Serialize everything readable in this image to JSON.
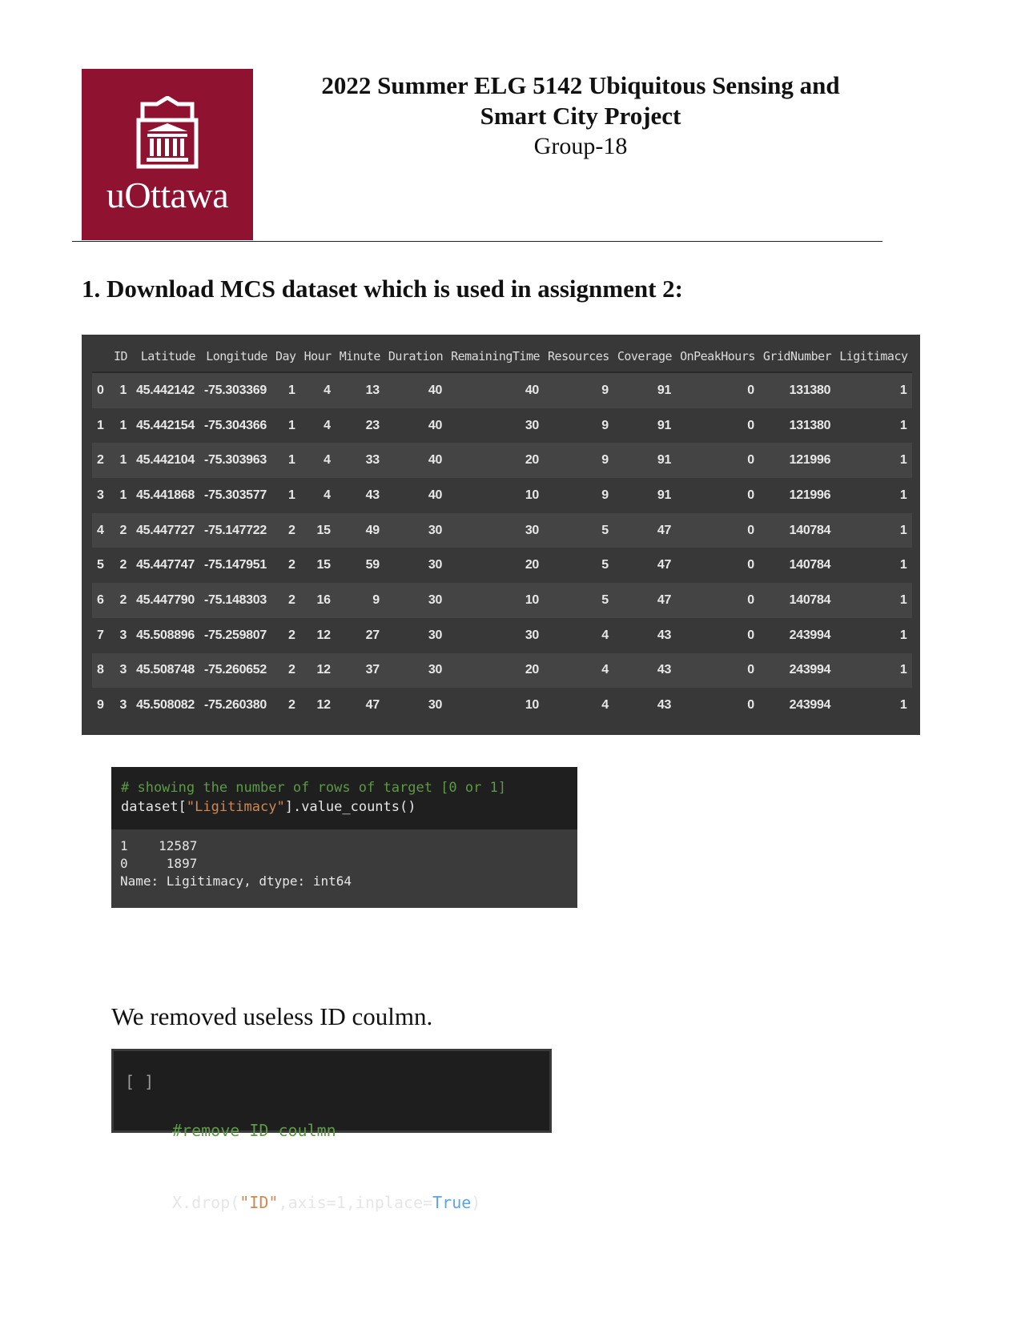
{
  "header": {
    "logo_text": "uOttawa",
    "title_line1": "2022 Summer ELG 5142 Ubiquitous Sensing and",
    "title_line2": "Smart City Project",
    "group": "Group-18"
  },
  "section": {
    "heading": "1. Download MCS dataset which is used in assignment 2:"
  },
  "colors": {
    "logo_bg": "#8f1330",
    "panel_bg": "#383838",
    "code_comment": "#5c9a45",
    "code_string": "#d1874f",
    "code_keyword": "#5aa4e8"
  },
  "dataframe": {
    "columns": [
      "",
      "ID",
      "Latitude",
      "Longitude",
      "Day",
      "Hour",
      "Minute",
      "Duration",
      "RemainingTime",
      "Resources",
      "Coverage",
      "OnPeakHours",
      "GridNumber",
      "Ligitimacy"
    ],
    "rows": [
      [
        "0",
        "1",
        "45.442142",
        "-75.303369",
        "1",
        "4",
        "13",
        "40",
        "40",
        "9",
        "91",
        "0",
        "131380",
        "1"
      ],
      [
        "1",
        "1",
        "45.442154",
        "-75.304366",
        "1",
        "4",
        "23",
        "40",
        "30",
        "9",
        "91",
        "0",
        "131380",
        "1"
      ],
      [
        "2",
        "1",
        "45.442104",
        "-75.303963",
        "1",
        "4",
        "33",
        "40",
        "20",
        "9",
        "91",
        "0",
        "121996",
        "1"
      ],
      [
        "3",
        "1",
        "45.441868",
        "-75.303577",
        "1",
        "4",
        "43",
        "40",
        "10",
        "9",
        "91",
        "0",
        "121996",
        "1"
      ],
      [
        "4",
        "2",
        "45.447727",
        "-75.147722",
        "2",
        "15",
        "49",
        "30",
        "30",
        "5",
        "47",
        "0",
        "140784",
        "1"
      ],
      [
        "5",
        "2",
        "45.447747",
        "-75.147951",
        "2",
        "15",
        "59",
        "30",
        "20",
        "5",
        "47",
        "0",
        "140784",
        "1"
      ],
      [
        "6",
        "2",
        "45.447790",
        "-75.148303",
        "2",
        "16",
        "9",
        "30",
        "10",
        "5",
        "47",
        "0",
        "140784",
        "1"
      ],
      [
        "7",
        "3",
        "45.508896",
        "-75.259807",
        "2",
        "12",
        "27",
        "30",
        "30",
        "4",
        "43",
        "0",
        "243994",
        "1"
      ],
      [
        "8",
        "3",
        "45.508748",
        "-75.260652",
        "2",
        "12",
        "37",
        "30",
        "20",
        "4",
        "43",
        "0",
        "243994",
        "1"
      ],
      [
        "9",
        "3",
        "45.508082",
        "-75.260380",
        "2",
        "12",
        "47",
        "30",
        "10",
        "4",
        "43",
        "0",
        "243994",
        "1"
      ]
    ]
  },
  "code_cell_1": {
    "comment": "# showing the number of rows of target [0 or 1]",
    "code_prefix": "dataset[",
    "code_string": "\"Ligitimacy\"",
    "code_suffix": "].value_counts()",
    "output_lines": [
      "1    12587",
      "0     1897",
      "Name: Ligitimacy, dtype: int64"
    ]
  },
  "paragraph": "We removed useless ID coulmn.",
  "code_cell_2": {
    "bracket": "[ ]",
    "comment": "#remove ID coulmn",
    "code_prefix": "X.drop(",
    "code_string": "\"ID\"",
    "code_middle": ",axis=1,inplace=",
    "code_keyword": "True",
    "code_suffix": ")"
  }
}
